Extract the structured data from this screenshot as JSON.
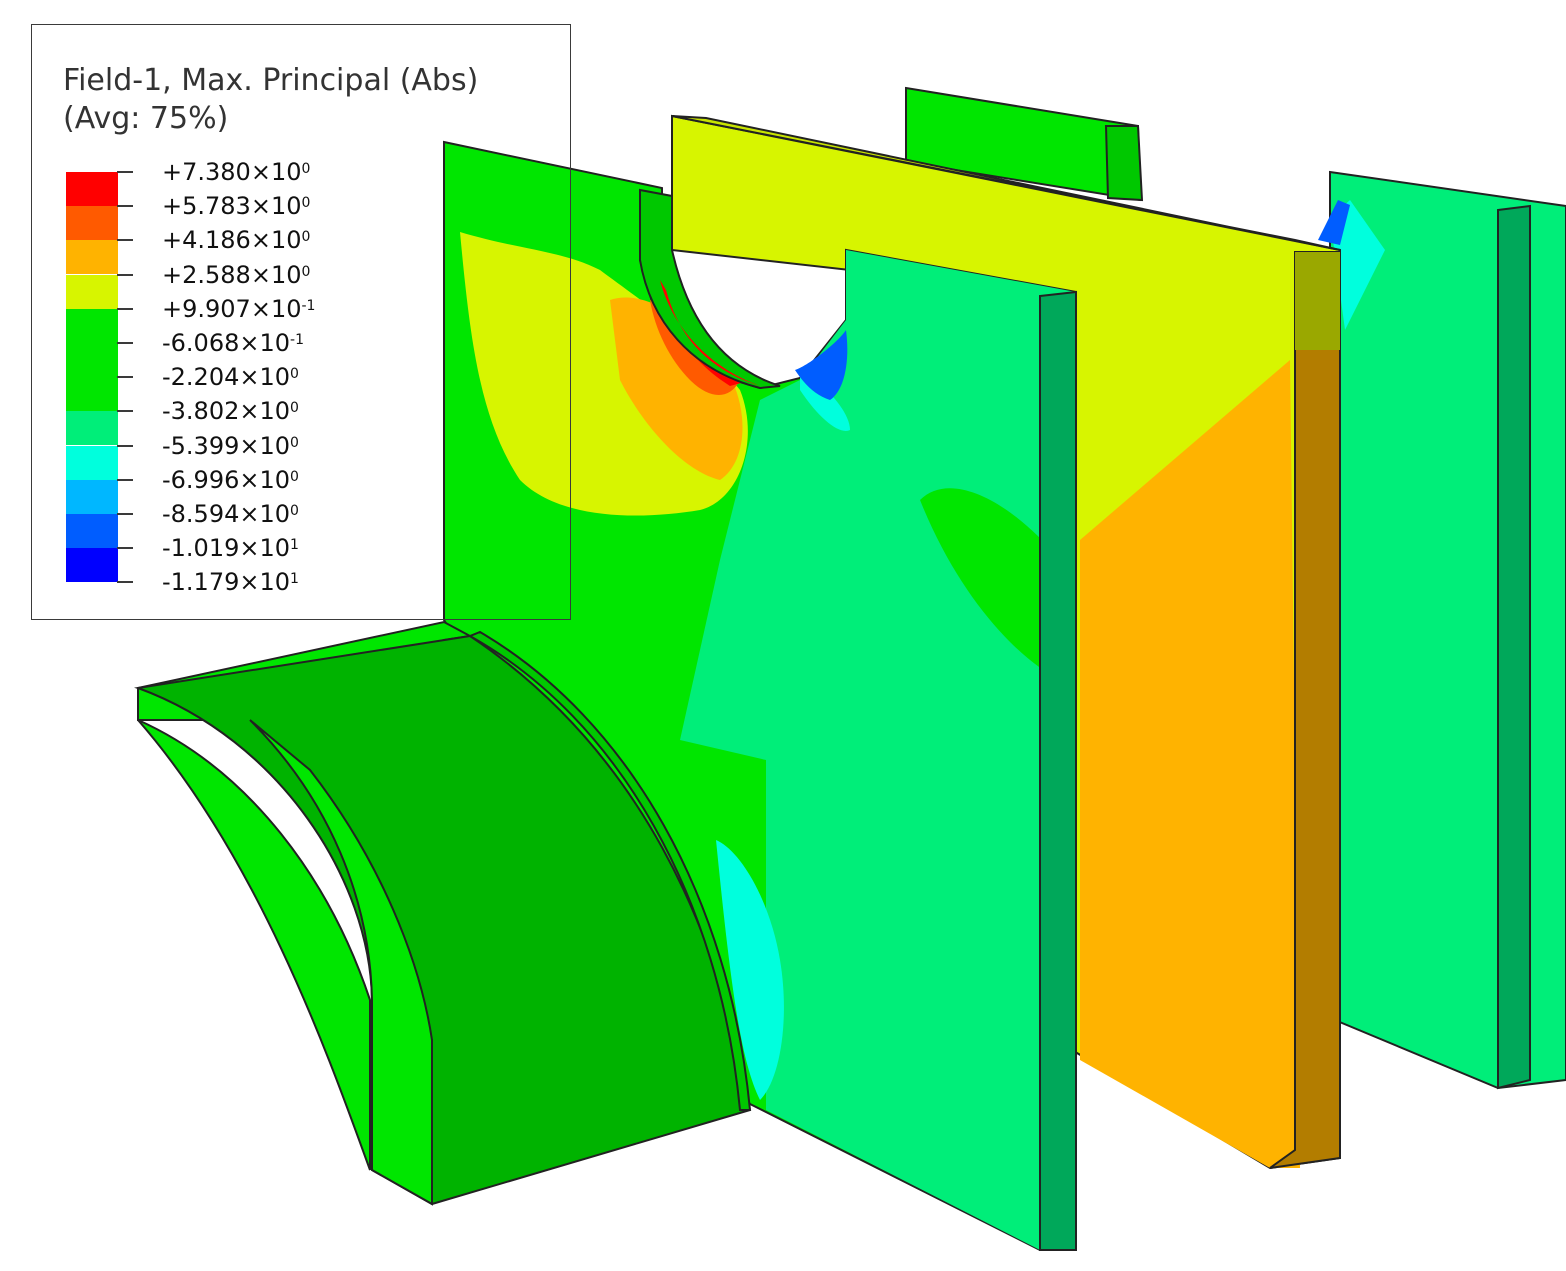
{
  "legend": {
    "title_line1": "Field-1, Max. Principal (Abs)",
    "title_line2": "(Avg: 75%)",
    "levels": [
      {
        "mantissa": "+7.380",
        "exponent": "0"
      },
      {
        "mantissa": "+5.783",
        "exponent": "0"
      },
      {
        "mantissa": "+4.186",
        "exponent": "0"
      },
      {
        "mantissa": "+2.588",
        "exponent": "0"
      },
      {
        "mantissa": "+9.907",
        "exponent": "-1"
      },
      {
        "mantissa": "-6.068",
        "exponent": "-1"
      },
      {
        "mantissa": "-2.204",
        "exponent": "0"
      },
      {
        "mantissa": "-3.802",
        "exponent": "0"
      },
      {
        "mantissa": "-5.399",
        "exponent": "0"
      },
      {
        "mantissa": "-6.996",
        "exponent": "0"
      },
      {
        "mantissa": "-8.594",
        "exponent": "0"
      },
      {
        "mantissa": "-1.019",
        "exponent": "1"
      },
      {
        "mantissa": "-1.179",
        "exponent": "1"
      }
    ],
    "times_symbol": "×",
    "base": "10",
    "band_colors": [
      "#ff0000",
      "#ff5a00",
      "#ffb300",
      "#d7f500",
      "#00e600",
      "#00e600",
      "#00e600",
      "#00ee79",
      "#00ffdd",
      "#00b7ff",
      "#005dff",
      "#0000ff"
    ]
  },
  "colors": {
    "red": "#ff0000",
    "orange_red": "#ff5a00",
    "orange": "#ffb300",
    "yellow_green": "#d7f500",
    "green": "#00e600",
    "mint": "#00ee79",
    "cyan": "#00ffdd",
    "sky": "#00b7ff",
    "blue": "#0000ff",
    "green_shade": "#00b300",
    "mint_shade": "#00a85a",
    "orange_shade": "#b37d00",
    "olive_shade": "#9aa800"
  }
}
